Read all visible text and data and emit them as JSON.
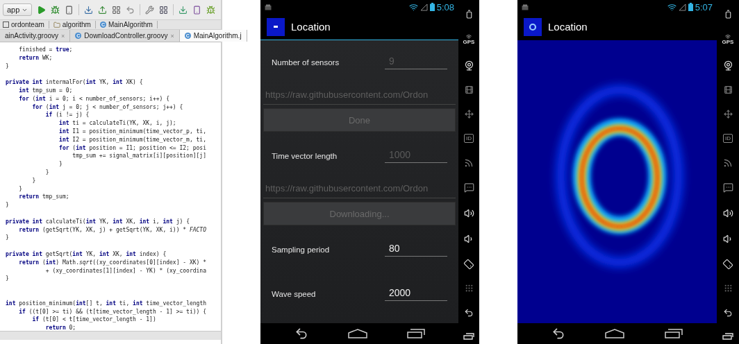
{
  "ide": {
    "run_config": "app",
    "breadcrumb": [
      {
        "label": "ordonteam",
        "kind": "module"
      },
      {
        "label": "algorithm",
        "kind": "folder"
      },
      {
        "label": "MainAlgorithm",
        "kind": "class",
        "badge": "C"
      }
    ],
    "tabs": [
      {
        "label": "ainActivity.groovy",
        "close": "×",
        "selected": false
      },
      {
        "label": "DownloadController.groovy",
        "badge": "C",
        "close": "×",
        "selected": false
      },
      {
        "label": "MainAlgorithm.j",
        "badge": "C",
        "selected": true
      }
    ],
    "code_blocks": [
      {
        "lines": [
          "    finished = **true**;",
          "    **return** WK;",
          "}"
        ]
      },
      {
        "gap_before": true,
        "lines": [
          "**private** **int** intermalFor(**int** YK, **int** XK) {",
          "    **int** tmp_sum = 0;",
          "    **for** (**int** i = 0; i < number_of_sensors; i++) {",
          "        **for** (**int** j = 0; j < number_of_sensors; j++) {",
          "            **if** (i != j) {",
          "                **int** ti = calculateTi(YK, XK, i, j);",
          "                **int** I1 = position_minimum(time_vector_p, ti,",
          "                **int** I2 = position_minimum(time_vector_m, ti,",
          "                **for** (**int** position = I1; position <= I2; posi",
          "                    tmp_sum += signal_matrix[i][position][j]",
          "                }",
          "            }",
          "        }",
          "    }",
          "    **return** tmp_sum;",
          "}"
        ]
      },
      {
        "gap_before": true,
        "lines": [
          "**private** **int** calculateTi(**int** YK, **int** XK, **int** i, **int** j) {",
          "    **return** (getSqrt(YK, XK, j) + getSqrt(YK, XK, i)) * *FACTO*",
          "}"
        ]
      },
      {
        "gap_before": true,
        "lines": [
          "**private** **int** getSqrt(**int** YK, **int** XK, **int** index) {",
          "    **return** (**int**) Math.*sqrt*((xy_coordinates[0][index] - XK) *",
          "            + (xy_coordinates[1][index] - YK) * (xy_coordina",
          "}"
        ]
      },
      {
        "gap_before": true,
        "wide_gap": true,
        "lines": [
          "**int** position_minimum(**int**[] t, **int** ti, **int** time_vector_length",
          "    **if** ((t[0] >= ti) && (t[time_vector_length - 1] >= ti)) {",
          "        **if** (t[0] < t[time_vector_length - 1])",
          "            **return** 0;"
        ]
      }
    ]
  },
  "phones": [
    {
      "kind": "form",
      "time": "5:08",
      "title": "Location",
      "sidebar": {
        "gps_label": "GPS",
        "id_label": "ID"
      },
      "form": [
        {
          "kind": "row",
          "label": "Number of sensors",
          "value": "9",
          "disabled": true
        },
        {
          "kind": "url",
          "value": "https://raw.githubusercontent.com/Ordon",
          "disabled": true
        },
        {
          "kind": "button",
          "label": "Done",
          "disabled": true
        },
        {
          "kind": "row",
          "label": "Time vector length",
          "value": "1000",
          "disabled": true
        },
        {
          "kind": "url",
          "value": "https://raw.githubusercontent.com/Ordon",
          "disabled": true
        },
        {
          "kind": "button",
          "label": "Downloading...",
          "disabled": true
        },
        {
          "kind": "row",
          "label": "Sampling period",
          "value": "80",
          "disabled": false
        },
        {
          "kind": "row",
          "label": "Wave speed",
          "value": "2000",
          "disabled": false
        }
      ]
    },
    {
      "kind": "heatmap",
      "time": "5:07",
      "title": "Location",
      "sidebar": {
        "gps_label": "GPS",
        "id_label": "ID"
      }
    }
  ]
}
